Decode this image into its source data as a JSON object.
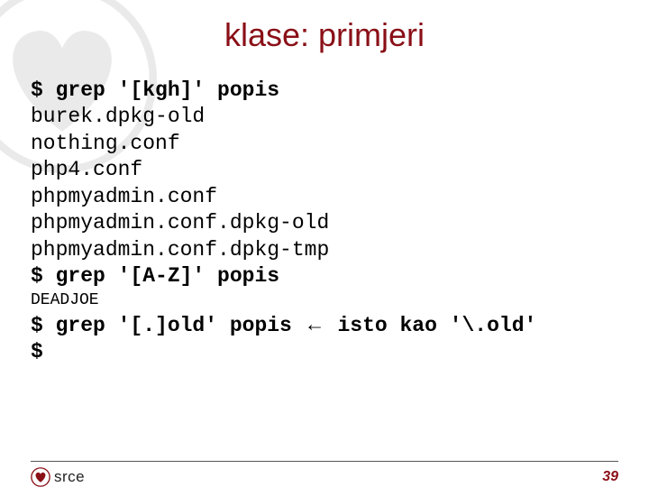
{
  "title": "klase: primjeri",
  "lines": [
    {
      "text": "$ grep '[kgh]' popis",
      "bold": true
    },
    {
      "text": "burek.dpkg-old"
    },
    {
      "text": "nothing.conf"
    },
    {
      "text": "php4.conf"
    },
    {
      "text": "phpmyadmin.conf"
    },
    {
      "text": "phpmyadmin.conf.dpkg-old"
    },
    {
      "text": "phpmyadmin.conf.dpkg-tmp"
    },
    {
      "text": "$ grep '[A-Z]' popis",
      "bold": true
    }
  ],
  "small_line": "DEADJOE",
  "grep3": {
    "left": "$ grep '[.]old' popis ",
    "arrow": "←",
    "right": " isto kao '\\.old'"
  },
  "prompt": "$",
  "footer": {
    "brand": "srce",
    "page": "39"
  }
}
